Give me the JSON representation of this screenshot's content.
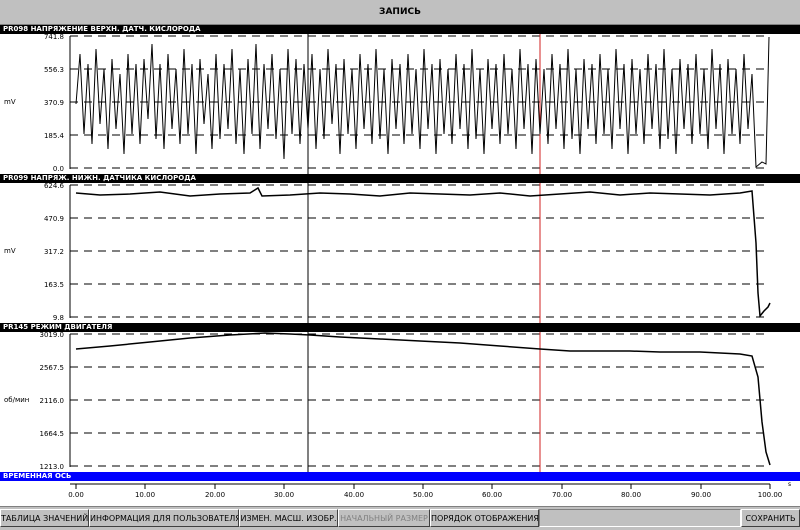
{
  "window": {
    "title": "ЗАПИСЬ"
  },
  "panels": [
    {
      "header": "PR098 НАПРЯЖЕНИЕ ВЕРХН. ДАТЧ. КИСЛОРОДА",
      "unit": "mV",
      "ticks": [
        "741.8",
        "556.3",
        "370.9",
        "185.4",
        "0.0"
      ]
    },
    {
      "header": "PR099 НАПРЯЖ. НИЖН. ДАТЧИКА КИСЛОРОДА",
      "unit": "mV",
      "ticks": [
        "624.6",
        "470.9",
        "317.2",
        "163.5",
        "9.8"
      ]
    },
    {
      "header": "PR145 РЕЖИМ ДВИГАТЕЛЯ",
      "unit": "об/мин",
      "ticks": [
        "3019.0",
        "2567.5",
        "2116.0",
        "1664.5",
        "1213.0"
      ]
    }
  ],
  "time_axis": {
    "header": "ВРЕМЕННАЯ ОСЬ",
    "unit": "s",
    "ticks": [
      "0.00",
      "10.00",
      "20.00",
      "30.00",
      "40.00",
      "50.00",
      "60.00",
      "70.00",
      "80.00",
      "90.00",
      "100.00"
    ]
  },
  "cursors": {
    "black_t": 33,
    "red_t": 66.5,
    "black_color": "#000000",
    "red_color": "#d02020"
  },
  "chart_data": [
    {
      "type": "line",
      "title": "PR098 НАПРЯЖЕНИЕ ВЕРХН. ДАТЧ. КИСЛОРОДА",
      "ylabel": "mV",
      "ylim": [
        0.0,
        741.8
      ],
      "xlim": [
        0,
        100
      ],
      "grid": true,
      "series": [
        {
          "name": "PR098",
          "shape": "oscillating 80–700 mV through t≈97, then drops near 0 and spikes to 741.8 at 100"
        }
      ]
    },
    {
      "type": "line",
      "title": "PR099 НАПРЯЖ. НИЖН. ДАТЧИКА КИСЛОРОДА",
      "ylabel": "mV",
      "ylim": [
        9.8,
        624.6
      ],
      "xlim": [
        0,
        100
      ],
      "grid": true,
      "series": [
        {
          "name": "PR099",
          "x": [
            0,
            10,
            20,
            27,
            30,
            40,
            50,
            60,
            70,
            80,
            90,
            96.5,
            97,
            98,
            99,
            100
          ],
          "y": [
            590,
            588,
            592,
            610,
            590,
            592,
            590,
            588,
            592,
            592,
            590,
            600,
            300,
            20,
            50,
            90
          ]
        }
      ]
    },
    {
      "type": "line",
      "title": "PR145 РЕЖИМ ДВИГАТЕЛЯ",
      "ylabel": "об/мин",
      "ylim": [
        1213.0,
        3019.0
      ],
      "xlim": [
        0,
        100
      ],
      "grid": true,
      "series": [
        {
          "name": "PR145",
          "x": [
            0,
            10,
            20,
            28,
            33,
            40,
            50,
            60,
            66.5,
            70,
            80,
            90,
            96,
            97,
            98,
            99,
            100
          ],
          "y": [
            2820,
            2880,
            2960,
            3019,
            2990,
            2950,
            2900,
            2840,
            2800,
            2780,
            2790,
            2770,
            2740,
            2600,
            2000,
            1500,
            1220
          ]
        }
      ]
    }
  ],
  "toolbar": {
    "buttons": [
      {
        "label": "ТАБЛИЦА ЗНАЧЕНИЙ",
        "enabled": true
      },
      {
        "label": "ИНФОРМАЦИЯ ДЛЯ ПОЛЬЗОВАТЕЛЯ",
        "enabled": true
      },
      {
        "label": "ИЗМЕН. МАСШ. ИЗОБР.",
        "enabled": true
      },
      {
        "label": "НАЧАЛЬНЫЙ РАЗМЕР",
        "enabled": false
      },
      {
        "label": "ПОРЯДОК ОТОБРАЖЕНИЯ",
        "enabled": true
      },
      {
        "label": "СОХРАНИТЬ",
        "enabled": true
      }
    ]
  }
}
